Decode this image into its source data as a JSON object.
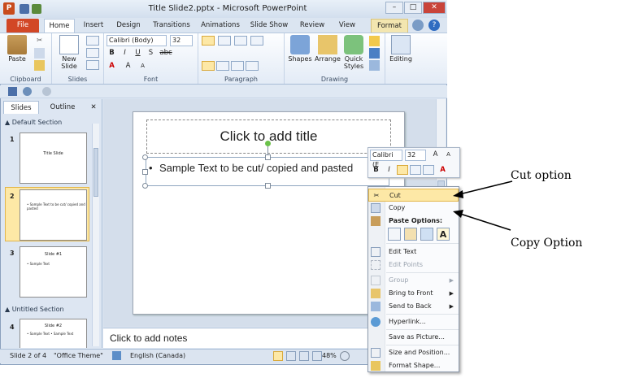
{
  "window": {
    "title": "Title Slide2.pptx - Microsoft PowerPoint",
    "app_icon": "P",
    "min_label": "–",
    "max_label": "□",
    "close_label": "✕"
  },
  "tabs": [
    "File",
    "Home",
    "Insert",
    "Design",
    "Transitions",
    "Animations",
    "Slide Show",
    "Review",
    "View",
    "Format"
  ],
  "ribbon": {
    "clipboard": {
      "label": "Clipboard",
      "paste": "Paste"
    },
    "slides": {
      "label": "Slides",
      "new_slide_1": "New",
      "new_slide_2": "Slide"
    },
    "font": {
      "label": "Font",
      "family": "Calibri (Body)",
      "size": "32",
      "bold": "B",
      "italic": "I",
      "underline": "U",
      "strike": "S",
      "shadow": "abc",
      "aa": "A"
    },
    "paragraph": {
      "label": "Paragraph"
    },
    "drawing": {
      "label": "Drawing",
      "shapes": "Shapes",
      "arrange": "Arrange",
      "quick_1": "Quick",
      "quick_2": "Styles"
    },
    "editing": {
      "label": "Editing"
    }
  },
  "left_pane": {
    "tab_slides": "Slides",
    "tab_outline": "Outline",
    "close": "✕",
    "section_default": "Default Section",
    "section_untitled": "Untitled Section",
    "thumbs": [
      {
        "num": "1",
        "title": "Title Slide",
        "body": ""
      },
      {
        "num": "2",
        "title": "",
        "body": "• Sample Text to be cut/ copied and pasted"
      },
      {
        "num": "3",
        "title": "Slide #1",
        "body": "• Sample Text"
      },
      {
        "num": "4",
        "title": "Slide #2",
        "body": "• Sample Text    • Sample Text"
      }
    ]
  },
  "slide": {
    "title_placeholder": "Click to add title",
    "bullet": "•",
    "body_text": "Sample Text to be cut/ copied and pasted"
  },
  "notes": {
    "placeholder": "Click to add notes"
  },
  "status": {
    "slide_info": "Slide 2 of 4",
    "theme": "\"Office Theme\"",
    "language": "English (Canada)",
    "zoom": "48%"
  },
  "mini_toolbar": {
    "font": "Calibri (E",
    "size": "32",
    "grow": "A",
    "shrink": "A",
    "bold": "B",
    "italic": "I",
    "color": "A"
  },
  "context_menu": {
    "cut": "Cut",
    "copy": "Copy",
    "paste_options": "Paste Options:",
    "paste_text": "A",
    "edit_text": "Edit Text",
    "edit_points": "Edit Points",
    "group": "Group",
    "bring_front": "Bring to Front",
    "send_back": "Send to Back",
    "hyperlink": "Hyperlink...",
    "save_picture": "Save as Picture...",
    "size_position": "Size and Position...",
    "format_shape": "Format Shape..."
  },
  "annotations": {
    "cut": "Cut option",
    "copy": "Copy Option"
  },
  "colors": {
    "file_tab": "#d24726",
    "accent": "#3b5998",
    "selection": "#fde8a6"
  }
}
